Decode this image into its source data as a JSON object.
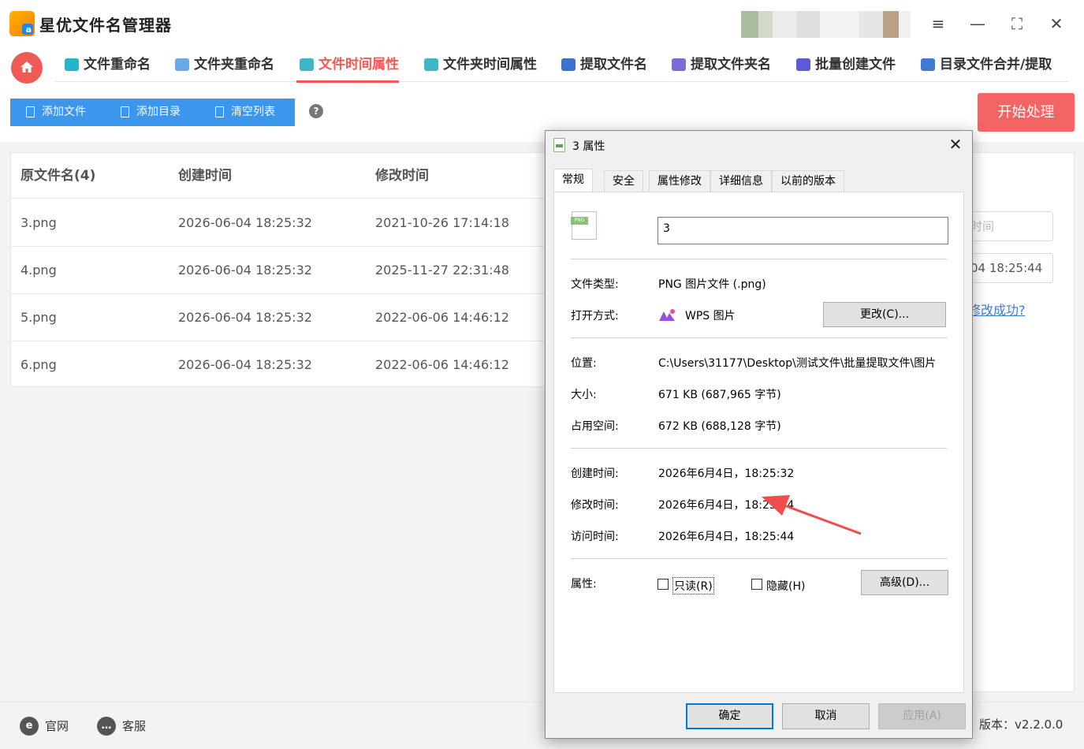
{
  "app": {
    "title": "星优文件名管理器",
    "accent": "#ef5a55"
  },
  "window_controls": {
    "settings": "≡",
    "minimize": "—",
    "maximize": "⛶",
    "close": "✕"
  },
  "nav": {
    "tabs": [
      {
        "label": "文件重命名",
        "icon": "rename-icon",
        "color": "#27b3c9"
      },
      {
        "label": "文件夹重命名",
        "icon": "folder-rename-icon",
        "color": "#6aa9e8"
      },
      {
        "label": "文件时间属性",
        "icon": "file-time-icon",
        "color": "#3fb6c6",
        "active": true
      },
      {
        "label": "文件夹时间属性",
        "icon": "folder-time-icon",
        "color": "#3fb6c6"
      },
      {
        "label": "提取文件名",
        "icon": "extract-filename-icon",
        "color": "#3f6fd1"
      },
      {
        "label": "提取文件夹名",
        "icon": "extract-foldername-icon",
        "color": "#7b6bd6"
      },
      {
        "label": "批量创建文件",
        "icon": "batch-create-icon",
        "color": "#5b5bd6"
      },
      {
        "label": "目录文件合并/提取",
        "icon": "merge-extract-icon",
        "color": "#3f7bd1"
      }
    ]
  },
  "toolbar": {
    "add_file": "添加文件",
    "add_dir": "添加目录",
    "clear_list": "清空列表",
    "help": "?",
    "start": "开始处理"
  },
  "table": {
    "headers": [
      "原文件名(4)",
      "创建时间",
      "修改时间"
    ],
    "rows": [
      [
        "3.png",
        "2026-06-04 18:25:32",
        "2021-10-26 17:14:18"
      ],
      [
        "4.png",
        "2026-06-04 18:25:32",
        "2025-11-27 22:31:48"
      ],
      [
        "5.png",
        "2026-06-04 18:25:32",
        "2022-06-06 14:46:12"
      ],
      [
        "6.png",
        "2026-06-04 18:25:32",
        "2022-06-06 14:46:12"
      ]
    ]
  },
  "right_panel": {
    "input1_placeholder": "时间",
    "input2_value": "04 18:25:44",
    "link": "修改成功?"
  },
  "footer": {
    "website": "官网",
    "support": "客服",
    "version": "版本：v2.2.0.0"
  },
  "dialog": {
    "title": "3 属性",
    "close": "✕",
    "tabs": [
      "常规",
      "安全",
      "属性修改",
      "详细信息",
      "以前的版本"
    ],
    "file_icon_tag": "PNG",
    "name": "3",
    "fields": {
      "type_label": "文件类型:",
      "type_value": "PNG 图片文件 (.png)",
      "open_label": "打开方式:",
      "open_value": "WPS 图片",
      "change_btn": "更改(C)...",
      "location_label": "位置:",
      "location_value": "C:\\Users\\31177\\Desktop\\测试文件\\批量提取文件\\图片",
      "size_label": "大小:",
      "size_value": "671 KB (687,965 字节)",
      "disk_label": "占用空间:",
      "disk_value": "672 KB (688,128 字节)",
      "created_label": "创建时间:",
      "created_value": "2026年6月4日，18:25:32",
      "modified_label": "修改时间:",
      "modified_value": "2026年6月4日，18:25:44",
      "accessed_label": "访问时间:",
      "accessed_value": "2026年6月4日，18:25:44",
      "attr_label": "属性:",
      "readonly_label": "只读(R)",
      "hidden_label": "隐藏(H)",
      "advanced_btn": "高级(D)..."
    },
    "buttons": {
      "ok": "确定",
      "cancel": "取消",
      "apply": "应用(A)"
    }
  }
}
